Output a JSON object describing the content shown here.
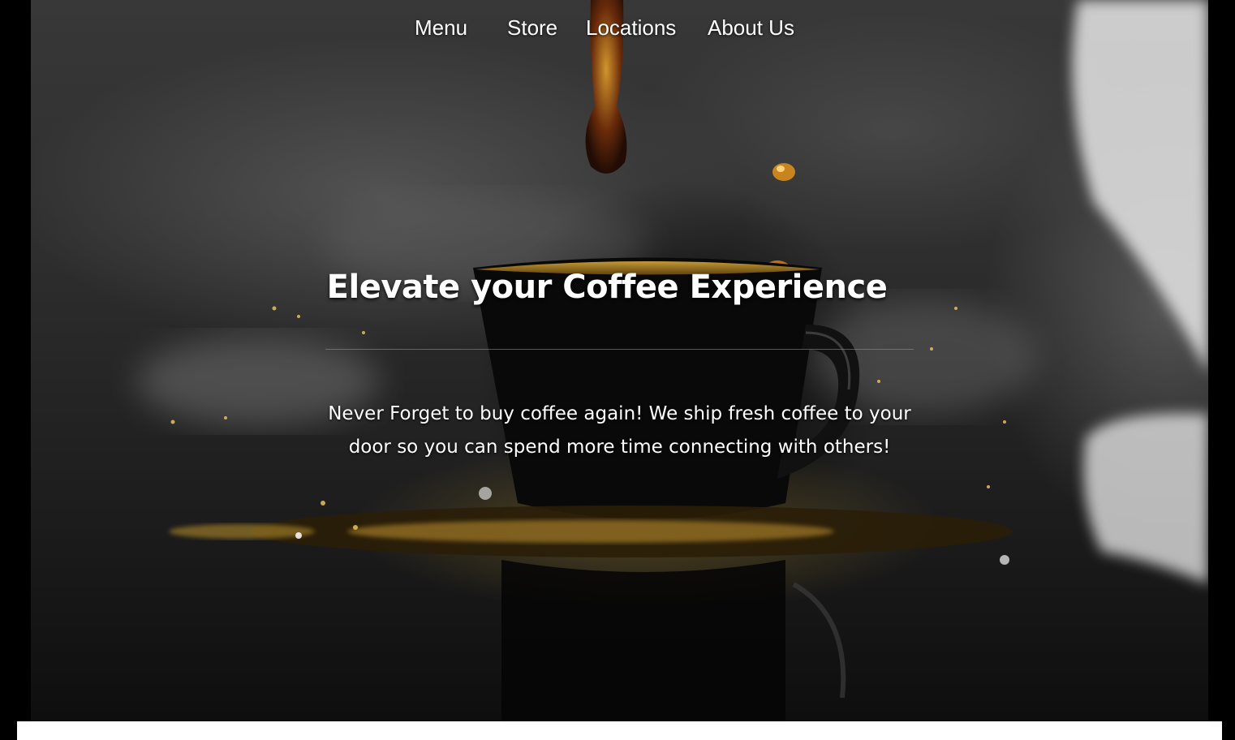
{
  "nav": {
    "items": [
      {
        "label": "Menu"
      },
      {
        "label": "Store"
      },
      {
        "label": "Locations"
      },
      {
        "label": "About Us"
      }
    ]
  },
  "hero": {
    "background_image": "coffee-cup-splash-photo",
    "headline": "Elevate your Coffee Experience",
    "tagline": "Never Forget to buy coffee again! We ship fresh coffee to your door so you can spend more time connecting with others!"
  },
  "colors": {
    "text": "#ffffff",
    "page_background": "#000000",
    "coffee_accent": "#c89a2a",
    "footer_strip": "#ffffff"
  }
}
